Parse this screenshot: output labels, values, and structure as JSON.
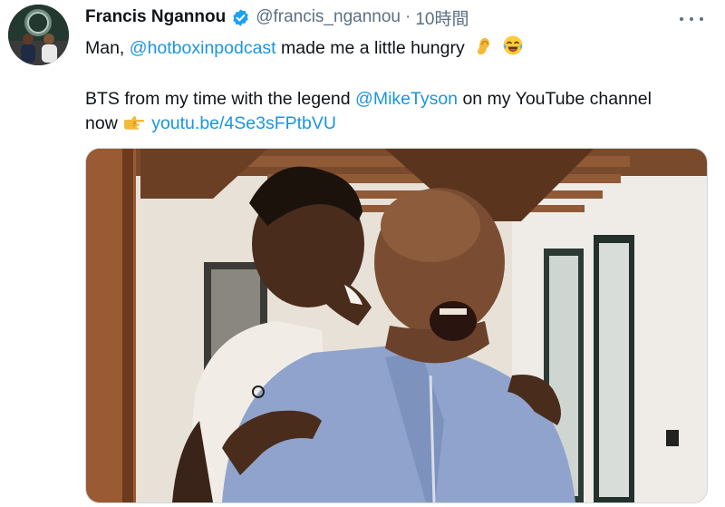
{
  "tweet": {
    "author_name": "Francis Ngannou",
    "handle": "@francis_ngannou",
    "separator": "·",
    "time": "10時間",
    "text_line1_before": "Man, ",
    "mention1": "@hotboxinpodcast",
    "text_line1_after": " made me a little hungry",
    "emoji1": "ear-emoji",
    "emoji2": "tears-of-joy-emoji",
    "text_line2_before": "BTS from my time with the legend ",
    "mention2": "@MikeTyson",
    "text_line2_after": " on my YouTube channel",
    "text_line3_before": "now ",
    "emoji3": "pointing-hand-emoji",
    "link": "youtu.be/4Se3sFPtbVU",
    "more_menu_icon": "more-icon",
    "verified_icon": "verified-badge-icon"
  },
  "colors": {
    "link": "#1b95e0",
    "secondary_text": "#5b7083",
    "verified": "#1da1f2",
    "media_border": "#cfd9de"
  }
}
